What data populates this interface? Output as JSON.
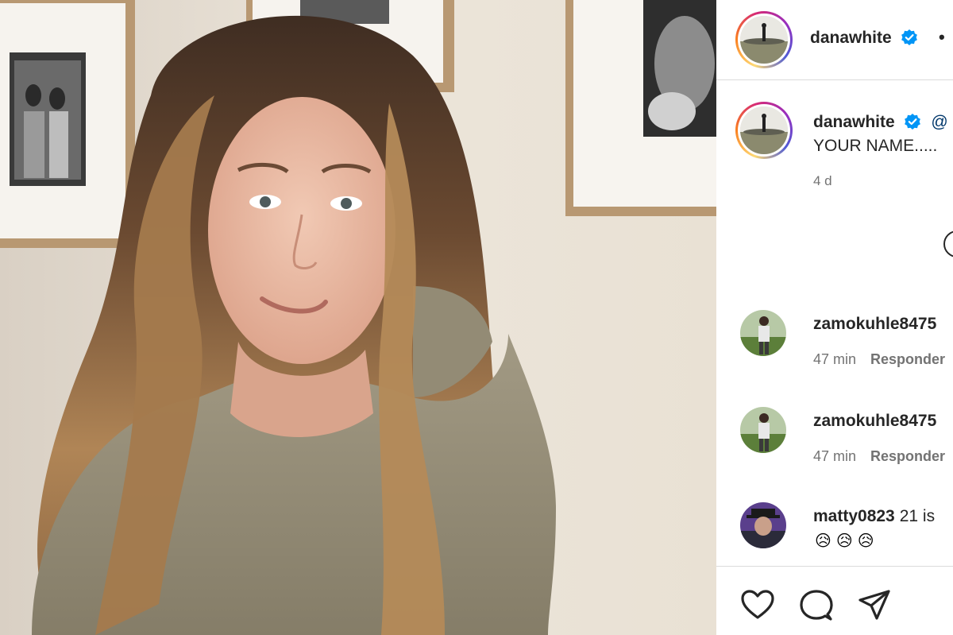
{
  "post": {
    "username": "danawhite",
    "separator": "•",
    "caption_handle": "@",
    "caption_text": "YOUR NAME.....",
    "caption_time": "4 d"
  },
  "comments": [
    {
      "user": "zamokuhle8475",
      "text": "",
      "time": "47 min",
      "reply": "Responder"
    },
    {
      "user": "zamokuhle8475",
      "text": "",
      "time": "47 min",
      "reply": "Responder"
    },
    {
      "user": "matty0823",
      "text": "21 is",
      "emojis": "😥😥😥"
    }
  ],
  "colors": {
    "verified": "#0095f6",
    "text_primary": "#262626",
    "text_secondary": "#737373",
    "divider": "#dbdbdb"
  },
  "icons": [
    "verified-badge-icon",
    "heart-icon",
    "comment-icon",
    "share-icon",
    "more-circle-icon"
  ]
}
